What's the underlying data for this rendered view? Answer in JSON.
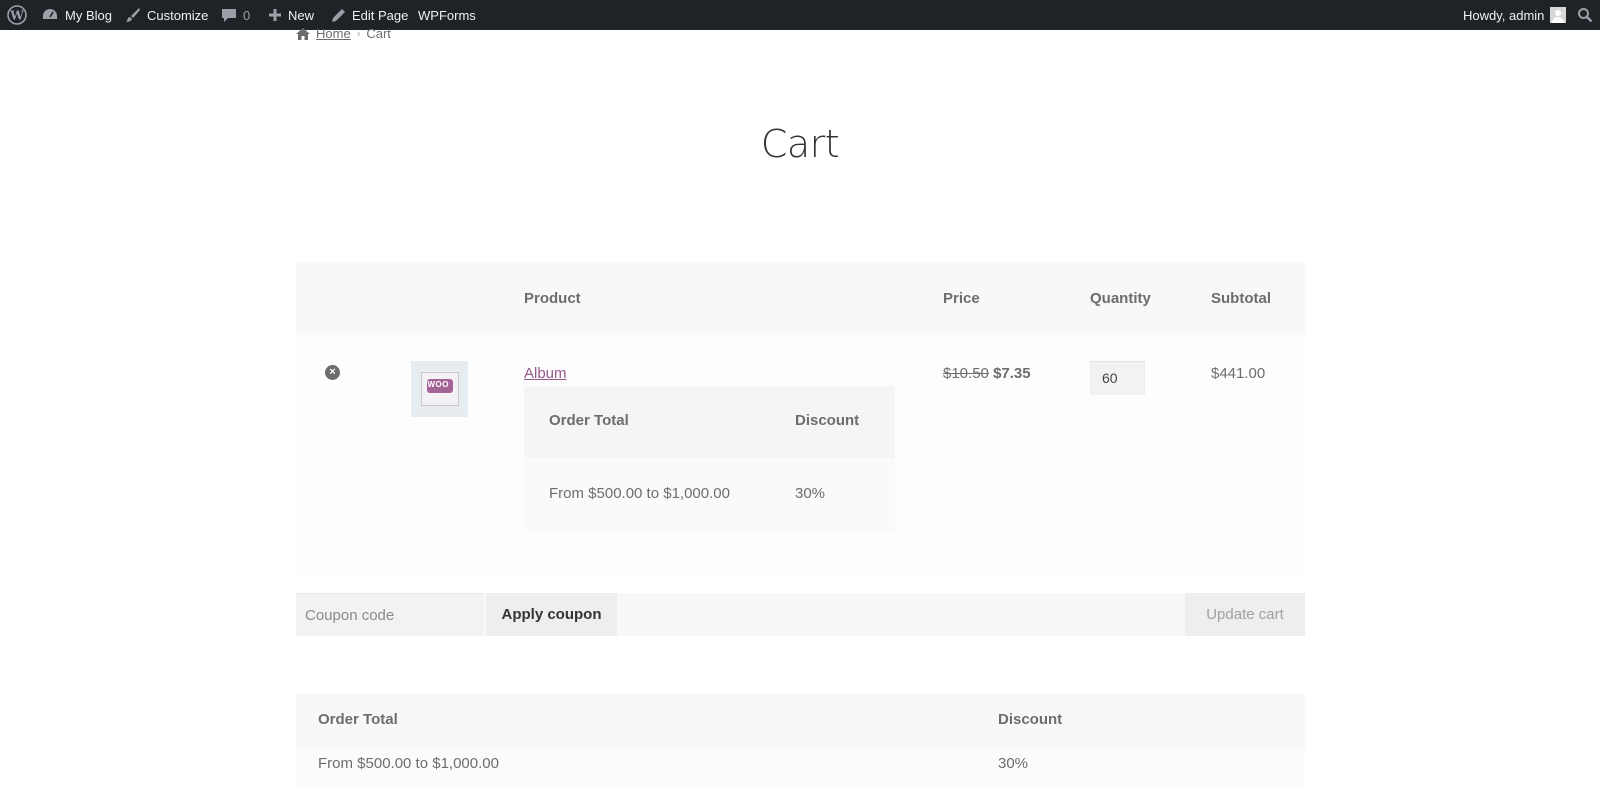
{
  "admin_bar": {
    "site_name": "My Blog",
    "customize": "Customize",
    "comments_count": "0",
    "new": "New",
    "edit_page": "Edit Page",
    "wpforms": "WPForms",
    "greeting": "Howdy, admin"
  },
  "breadcrumb": {
    "home": "Home",
    "current": "Cart"
  },
  "page": {
    "title": "Cart"
  },
  "cart_table": {
    "headers": {
      "product": "Product",
      "price": "Price",
      "quantity": "Quantity",
      "subtotal": "Subtotal"
    },
    "items": [
      {
        "name": "Album",
        "price_old": "$10.50",
        "price_new": "$7.35",
        "quantity": "60",
        "subtotal": "$441.00",
        "discount_table": {
          "headers": {
            "order_total": "Order Total",
            "discount": "Discount"
          },
          "rows": [
            {
              "range": "From $500.00 to $1,000.00",
              "discount": "30%"
            }
          ]
        }
      }
    ]
  },
  "actions": {
    "coupon_placeholder": "Coupon code",
    "apply_coupon": "Apply coupon",
    "update_cart": "Update cart"
  },
  "discount_table": {
    "headers": {
      "order_total": "Order Total",
      "discount": "Discount"
    },
    "rows": [
      {
        "range": "From $500.00 to $1,000.00",
        "discount": "30%"
      }
    ]
  },
  "colors": {
    "admin_bar_bg": "#1d2327",
    "link_purple": "#96588a",
    "text": "#6d6d6d",
    "title": "#333333"
  }
}
